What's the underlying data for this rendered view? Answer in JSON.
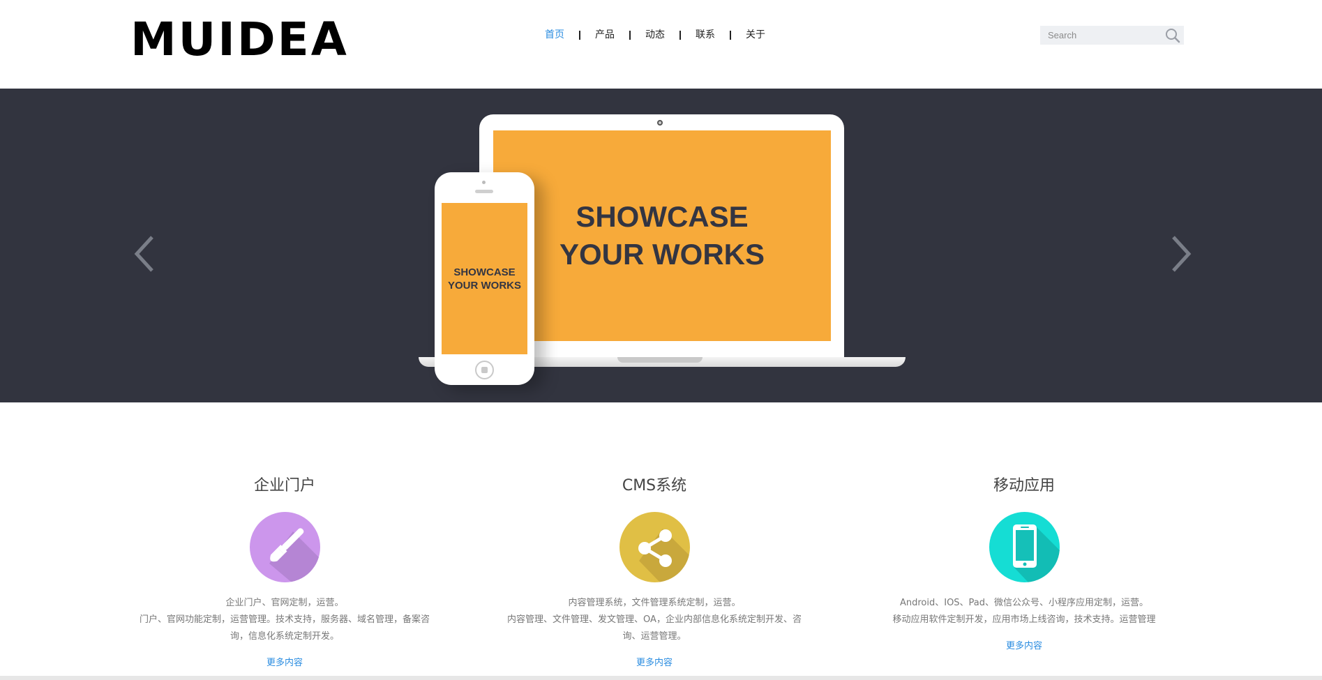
{
  "header": {
    "logo": "MUIDEA",
    "nav": [
      {
        "label": "首页",
        "active": true
      },
      {
        "label": "产品",
        "active": false
      },
      {
        "label": "动态",
        "active": false
      },
      {
        "label": "联系",
        "active": false
      },
      {
        "label": "关于",
        "active": false
      }
    ],
    "search": {
      "placeholder": "Search",
      "icon": "search-icon"
    }
  },
  "banner": {
    "laptop_text_line1": "SHOWCASE",
    "laptop_text_line2": "YOUR WORKS",
    "phone_text_line1": "SHOWCASE",
    "phone_text_line2": "YOUR WORKS",
    "prev_icon": "chevron-left-icon",
    "next_icon": "chevron-right-icon",
    "screen_color": "#f7aa3a",
    "background_color": "#32343f"
  },
  "features": [
    {
      "title": "企业门户",
      "icon": "paintbrush-icon",
      "color": "#cc96ec",
      "desc_lines": [
        "企业门户、官网定制，运营。",
        "门户、官网功能定制，运营管理。技术支持，服务器、域名管理，备案咨",
        "询，信息化系统定制开发。"
      ],
      "more": "更多内容"
    },
    {
      "title": "CMS系统",
      "icon": "share-icon",
      "color": "#e0bf45",
      "desc_lines": [
        "内容管理系统，文件管理系统定制，运营。",
        "内容管理、文件管理、发文管理、OA，企业内部信息化系统定制开发、咨",
        "询、运营管理。"
      ],
      "more": "更多内容"
    },
    {
      "title": "移动应用",
      "icon": "smartphone-icon",
      "color": "#15ddd4",
      "desc_lines": [
        "Android、IOS、Pad、微信公众号、小程序应用定制，运营。",
        "移动应用软件定制开发，应用市场上线咨询，技术支持。运营管理"
      ],
      "more": "更多内容"
    }
  ],
  "colors": {
    "accent": "#2a8ce0"
  }
}
